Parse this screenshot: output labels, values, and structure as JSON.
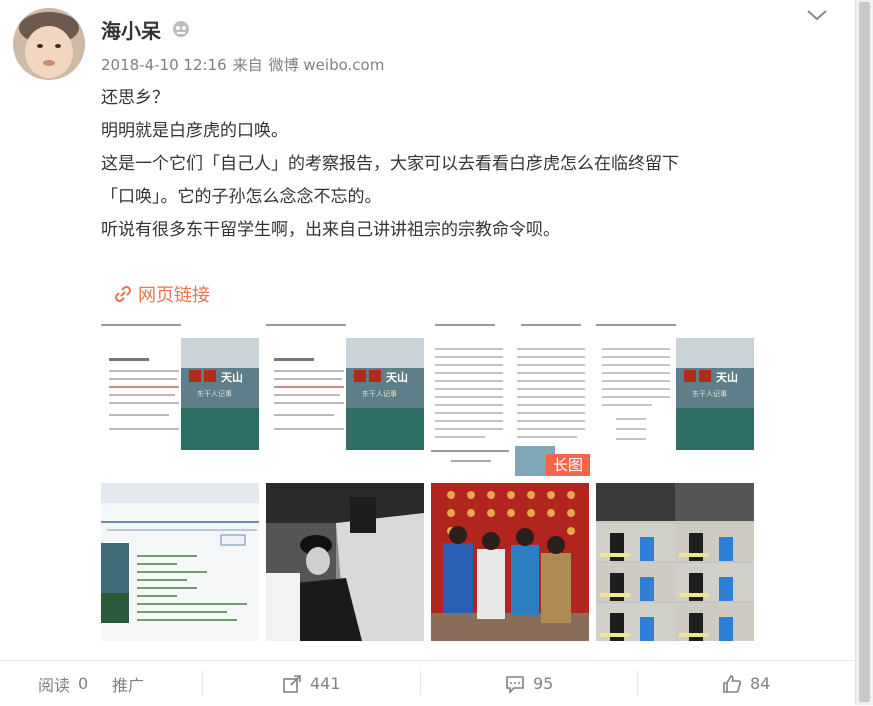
{
  "post": {
    "author": "海小呆",
    "timestamp": "2018-4-10 12:16",
    "source_prefix": "来自",
    "source": "微博 weibo.com",
    "lines": [
      "还思乡？",
      "明明就是白彦虎的口唤。",
      "这是一个它们「自己人」的考察报告，大家可以去看看白彦虎怎么在临终留下",
      "「口唤」。它的子孙怎么念念不忘的。",
      "听说有很多东干留学生啊，出来自己讲讲祖宗的宗教命令呗。"
    ],
    "link_label": "网页链接",
    "long_image_badge": "长图",
    "book_cover_title": "天山",
    "book_cover_sub": "东干人记事"
  },
  "footer": {
    "read_label": "阅读",
    "read_count": "0",
    "promote_label": "推广",
    "repost_count": "441",
    "comment_count": "95",
    "like_count": "84"
  },
  "colors": {
    "accent": "#eb7350",
    "badge": "#f8644a",
    "text": "#333333",
    "muted": "#808080"
  }
}
